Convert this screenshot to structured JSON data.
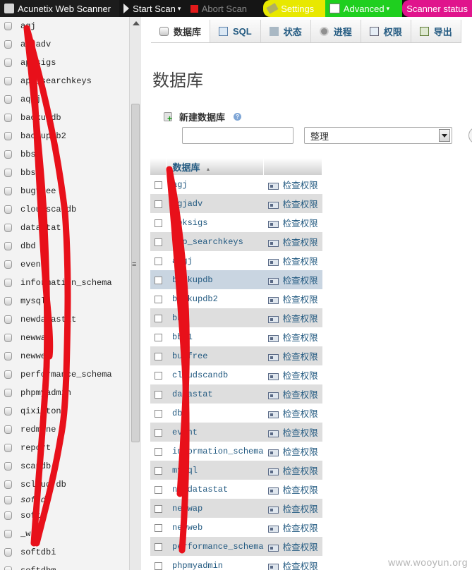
{
  "toolbar": {
    "app_title": "Acunetix Web Scanner",
    "start_scan": "Start Scan",
    "stop_scan": "Abort Scan",
    "settings": "Settings",
    "advanced": "Advanced",
    "scanner_status": "Scanner status"
  },
  "sidebar": {
    "items": [
      {
        "label": "agj"
      },
      {
        "label": "agjadv"
      },
      {
        "label": "apksigs"
      },
      {
        "label": "app_searchkeys"
      },
      {
        "label": "aqgj"
      },
      {
        "label": "backupdb"
      },
      {
        "label": "backupdb2"
      },
      {
        "label": "bbs"
      },
      {
        "label": "bbs1"
      },
      {
        "label": "bugfree"
      },
      {
        "label": "cloudscandb"
      },
      {
        "label": "datastat"
      },
      {
        "label": "dbd"
      },
      {
        "label": "event"
      },
      {
        "label": "information_schema"
      },
      {
        "label": "mysql"
      },
      {
        "label": "newdatastat"
      },
      {
        "label": "newwap"
      },
      {
        "label": "newweb"
      },
      {
        "label": "performance_schema"
      },
      {
        "label": "phpmyadmin"
      },
      {
        "label": "qixintong"
      },
      {
        "label": "redmine"
      },
      {
        "label": "report"
      },
      {
        "label": "scandb"
      },
      {
        "label": "scloud db"
      },
      {
        "label": "softd"
      },
      {
        "label": "softp"
      },
      {
        "label": "_w"
      },
      {
        "label": "softdbi"
      },
      {
        "label": "softdbm"
      }
    ]
  },
  "tabs": [
    {
      "label": "数据库",
      "icon": "database-icon"
    },
    {
      "label": "SQL",
      "icon": "sql-icon"
    },
    {
      "label": "状态",
      "icon": "status-icon"
    },
    {
      "label": "进程",
      "icon": "process-icon"
    },
    {
      "label": "权限",
      "icon": "privileges-icon"
    },
    {
      "label": "导出",
      "icon": "export-icon"
    }
  ],
  "page": {
    "title": "数据库",
    "create_label": "新建数据库",
    "db_name_placeholder": "",
    "collation_selected": "整理"
  },
  "table": {
    "header_name": "数据库",
    "action_label": "检查权限",
    "rows": [
      {
        "name": "agj"
      },
      {
        "name": "agjadv"
      },
      {
        "name": "apksigs"
      },
      {
        "name": "app_searchkeys"
      },
      {
        "name": "aqgj"
      },
      {
        "name": "backupdb"
      },
      {
        "name": "backupdb2"
      },
      {
        "name": "bbs"
      },
      {
        "name": "bbs1"
      },
      {
        "name": "bugfree"
      },
      {
        "name": "cloudscandb"
      },
      {
        "name": "datastat"
      },
      {
        "name": "dbd"
      },
      {
        "name": "event"
      },
      {
        "name": "information_schema"
      },
      {
        "name": "mysql"
      },
      {
        "name": "newdatastat"
      },
      {
        "name": "newwap"
      },
      {
        "name": "newweb"
      },
      {
        "name": "performance_schema"
      },
      {
        "name": "phpmyadmin"
      }
    ]
  },
  "watermark": "www.wooyun.org",
  "colors": {
    "link": "#235a81",
    "annotation": "#e8101a",
    "row_alt": "#dedede",
    "row_highlight": "#c9d5e1"
  }
}
